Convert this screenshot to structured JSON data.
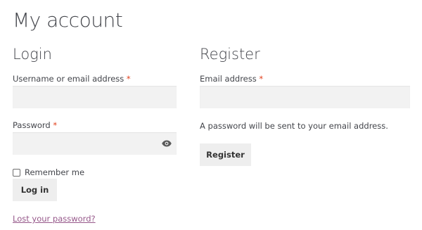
{
  "page": {
    "title": "My account"
  },
  "login": {
    "heading": "Login",
    "username_label": "Username or email address",
    "required_mark": "*",
    "username_value": "",
    "password_label": "Password",
    "password_value": "",
    "remember_label": "Remember me",
    "remember_checked": false,
    "login_button": "Log in",
    "lost_password_link": "Lost your password?"
  },
  "register": {
    "heading": "Register",
    "email_label": "Email address",
    "required_mark": "*",
    "email_value": "",
    "note": "A password will be sent to your email address.",
    "register_button": "Register"
  },
  "icons": {
    "password_toggle": "eye-icon"
  },
  "colors": {
    "text": "#43454b",
    "required": "#e2401c",
    "field_bg": "#f2f2f2",
    "button_bg": "#eeeeee",
    "link": "#96588a"
  }
}
